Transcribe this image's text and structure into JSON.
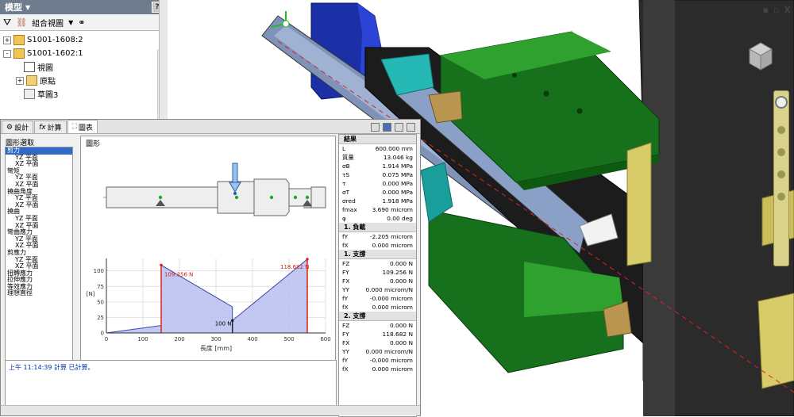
{
  "browser": {
    "title": "模型",
    "toolbar": {
      "view_label": "組合視圖"
    },
    "tree": [
      {
        "label": "S1001-1608:2",
        "expand": "+"
      },
      {
        "label": "S1001-1602:1",
        "expand": "-"
      },
      {
        "label": "視圖",
        "expand": ""
      },
      {
        "label": "原點",
        "expand": "+"
      },
      {
        "label": "草圖3",
        "expand": ""
      }
    ]
  },
  "tabs": [
    {
      "label": "設計"
    },
    {
      "label": "計算"
    },
    {
      "label": "圖表",
      "active": true
    }
  ],
  "graph_selection": {
    "label": "圖形選取",
    "items": [
      {
        "label": "剪力",
        "sub": false,
        "selected": true
      },
      {
        "label": "YZ 平面",
        "sub": true
      },
      {
        "label": "XZ 平面",
        "sub": true
      },
      {
        "label": "彎矩",
        "sub": false
      },
      {
        "label": "YZ 平面",
        "sub": true
      },
      {
        "label": "XZ 平面",
        "sub": true
      },
      {
        "label": "撓曲角度",
        "sub": false
      },
      {
        "label": "YZ 平面",
        "sub": true
      },
      {
        "label": "XZ 平面",
        "sub": true
      },
      {
        "label": "撓曲",
        "sub": false
      },
      {
        "label": "YZ 平面",
        "sub": true
      },
      {
        "label": "XZ 平面",
        "sub": true
      },
      {
        "label": "彎曲應力",
        "sub": false
      },
      {
        "label": "YZ 平面",
        "sub": true
      },
      {
        "label": "XZ 平面",
        "sub": true
      },
      {
        "label": "剪應力",
        "sub": false
      },
      {
        "label": "YZ 平面",
        "sub": true
      },
      {
        "label": "XZ 平面",
        "sub": true
      },
      {
        "label": "扭轉應力",
        "sub": false
      },
      {
        "label": "拉伸應力",
        "sub": false
      },
      {
        "label": "等效應力",
        "sub": false
      },
      {
        "label": "理想直徑",
        "sub": false
      }
    ]
  },
  "diagram": {
    "label": "圖形"
  },
  "load_labels": {
    "load": "100 N"
  },
  "chart_data": {
    "type": "area",
    "xlabel": "長度 [mm]",
    "ylabel": "[N]",
    "xlim": [
      0,
      600
    ],
    "ylim": [
      0,
      120
    ],
    "x_ticks": [
      0,
      100,
      200,
      300,
      400,
      500,
      600
    ],
    "y_ticks": [
      0,
      25,
      50,
      75,
      100
    ],
    "x": [
      0,
      150,
      150,
      345,
      345,
      550,
      550
    ],
    "y": [
      0,
      12,
      109.256,
      42,
      20,
      118.682,
      0
    ],
    "annotations": [
      {
        "x": 150,
        "y": 109.256,
        "text": "109.256 N"
      },
      {
        "x": 345,
        "y": 20,
        "text": "100 N"
      },
      {
        "x": 550,
        "y": 118.682,
        "text": "118.682 N"
      }
    ],
    "grid": true
  },
  "results": {
    "header": "結果",
    "rows": [
      {
        "label": "L",
        "value": "600.000 mm"
      },
      {
        "label": "質量",
        "value": "13.046 kg"
      },
      {
        "label": "σB",
        "value": "1.914 MPa"
      },
      {
        "label": "τS",
        "value": "0.075 MPa"
      },
      {
        "label": "τ",
        "value": "0.000 MPa"
      },
      {
        "label": "σT",
        "value": "0.000 MPa"
      },
      {
        "label": "σred",
        "value": "1.918 MPa"
      },
      {
        "label": "fmax",
        "value": "3.690 microm"
      },
      {
        "label": "φ",
        "value": "0.00 deg"
      }
    ],
    "sections": [
      {
        "header": "1. 負載",
        "rows": [
          {
            "label": "fY",
            "value": "-2.205 microm"
          },
          {
            "label": "fX",
            "value": "0.000 microm"
          }
        ]
      },
      {
        "header": "1. 支撐",
        "rows": [
          {
            "label": "FZ",
            "value": "0.000 N"
          },
          {
            "label": "FY",
            "value": "109.256 N"
          },
          {
            "label": "FX",
            "value": "0.000 N"
          },
          {
            "label": "YY",
            "value": "0.000 microm/N"
          },
          {
            "label": "fY",
            "value": "-0.000 microm"
          },
          {
            "label": "fX",
            "value": "0.000 microm"
          }
        ]
      },
      {
        "header": "2. 支撐",
        "rows": [
          {
            "label": "FZ",
            "value": "0.000 N"
          },
          {
            "label": "FY",
            "value": "118.682 N"
          },
          {
            "label": "FX",
            "value": "0.000 N"
          },
          {
            "label": "YY",
            "value": "0.000 microm/N"
          },
          {
            "label": "fY",
            "value": "-0.000 microm"
          },
          {
            "label": "fX",
            "value": "0.000 microm"
          }
        ]
      }
    ]
  },
  "status": {
    "text": "上午 11:14:39 計算 已計算。"
  }
}
